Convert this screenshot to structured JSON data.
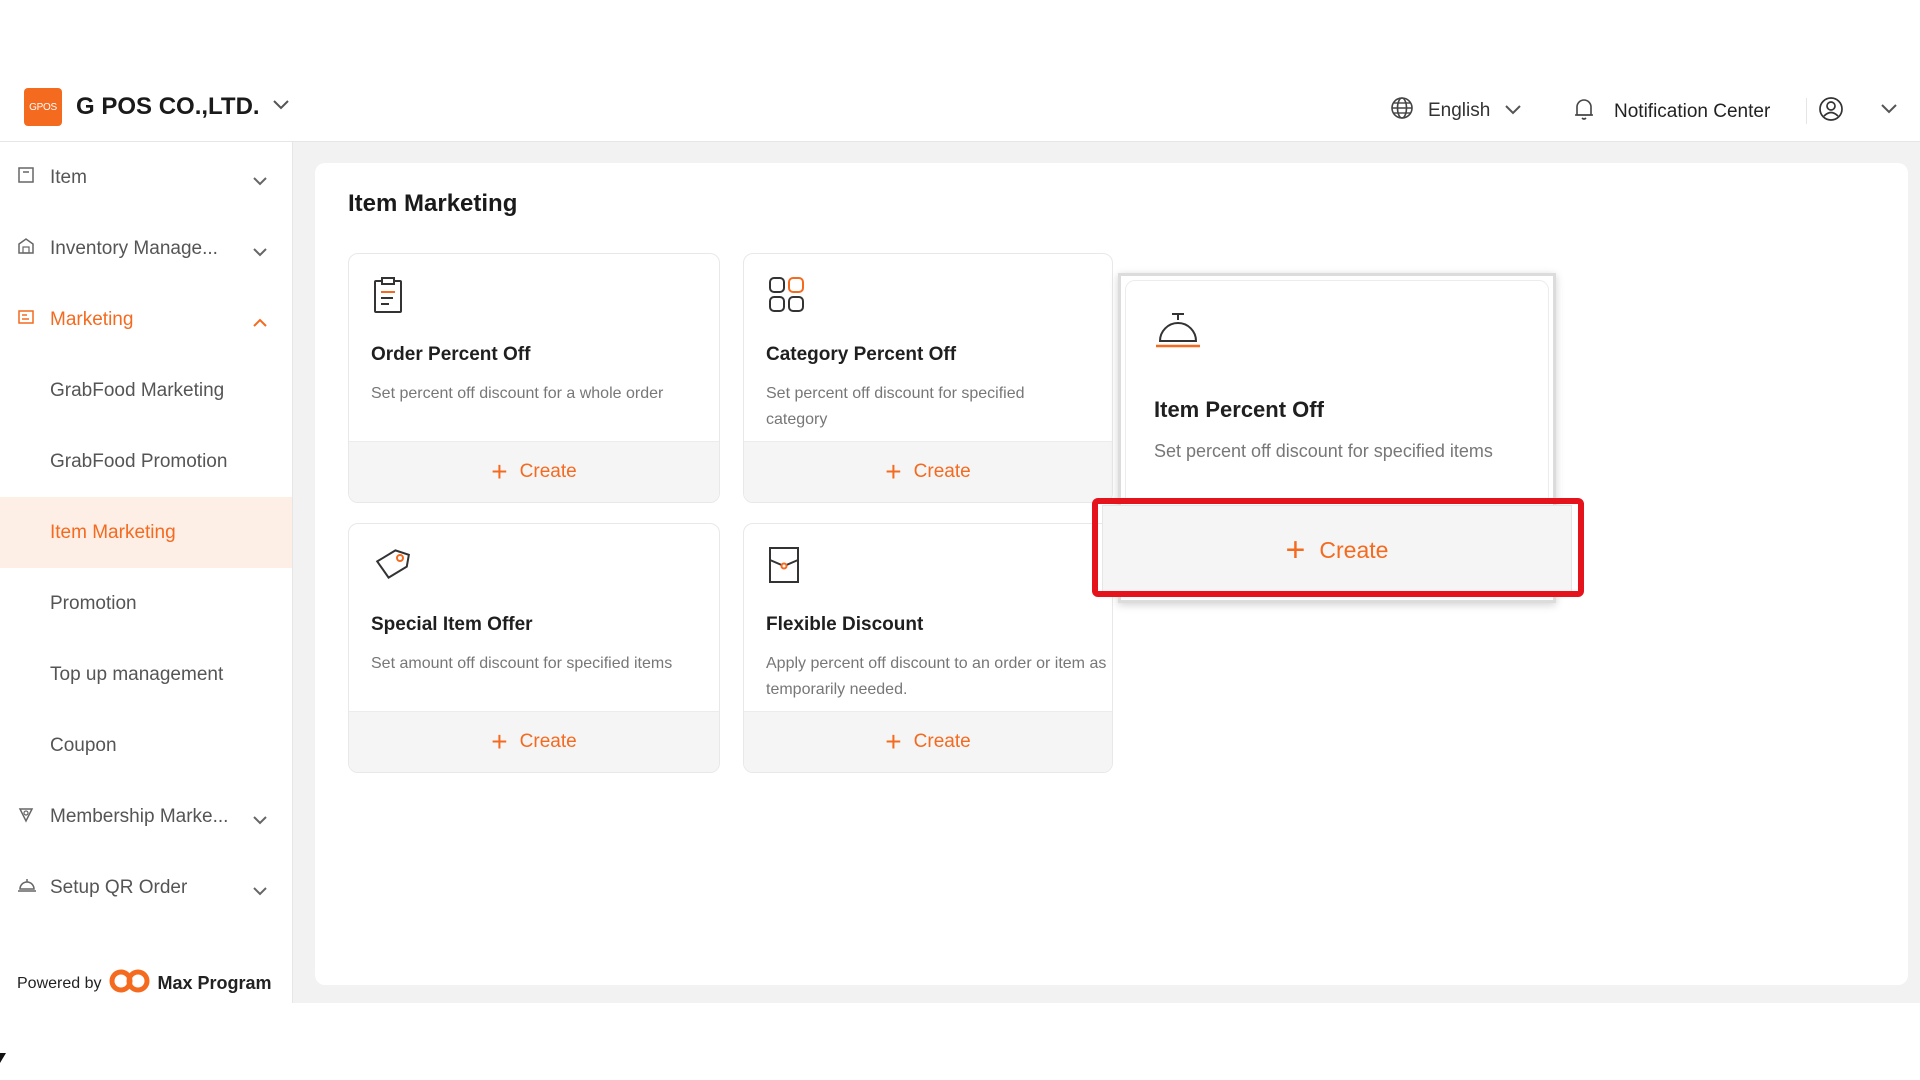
{
  "header": {
    "logo_text": "GPOS",
    "company": "G POS CO.,LTD.",
    "language": "English",
    "notification": "Notification Center"
  },
  "sidebar": {
    "items": [
      {
        "label": "Item",
        "icon": "item-icon"
      },
      {
        "label": "Inventory Manage...",
        "icon": "inventory-icon"
      },
      {
        "label": "Marketing",
        "icon": "marketing-icon"
      },
      {
        "label": "Membership Marke...",
        "icon": "membership-icon"
      },
      {
        "label": "Setup QR Order",
        "icon": "qr-order-icon"
      }
    ],
    "marketing_sub": [
      "GrabFood Marketing",
      "GrabFood Promotion",
      "Item Marketing",
      "Promotion",
      "Top up management",
      "Coupon"
    ],
    "powered_by": "Powered by",
    "brand": "Max Program"
  },
  "main": {
    "title": "Item Marketing",
    "cards": [
      {
        "title": "Order Percent Off",
        "desc": "Set percent off discount for a whole order",
        "button": "Create",
        "icon": "clipboard-icon"
      },
      {
        "title": "Category Percent Off",
        "desc": "Set percent off discount for specified category",
        "button": "Create",
        "icon": "category-grid-icon"
      },
      {
        "title": "Item Percent Off",
        "desc": "Set percent off discount for specified items",
        "button": "Create",
        "icon": "service-bell-icon"
      },
      {
        "title": "Special Item Offer",
        "desc": "Set amount off discount for specified items",
        "button": "Create",
        "icon": "tag-icon"
      },
      {
        "title": "Flexible Discount",
        "desc": "Apply percent off discount to an order or item as temporarily needed.",
        "button": "Create",
        "icon": "envelope-icon"
      }
    ]
  },
  "colors": {
    "accent": "#f46a1f",
    "highlight": "#e5131b",
    "selected_bg": "#fdeee6"
  }
}
